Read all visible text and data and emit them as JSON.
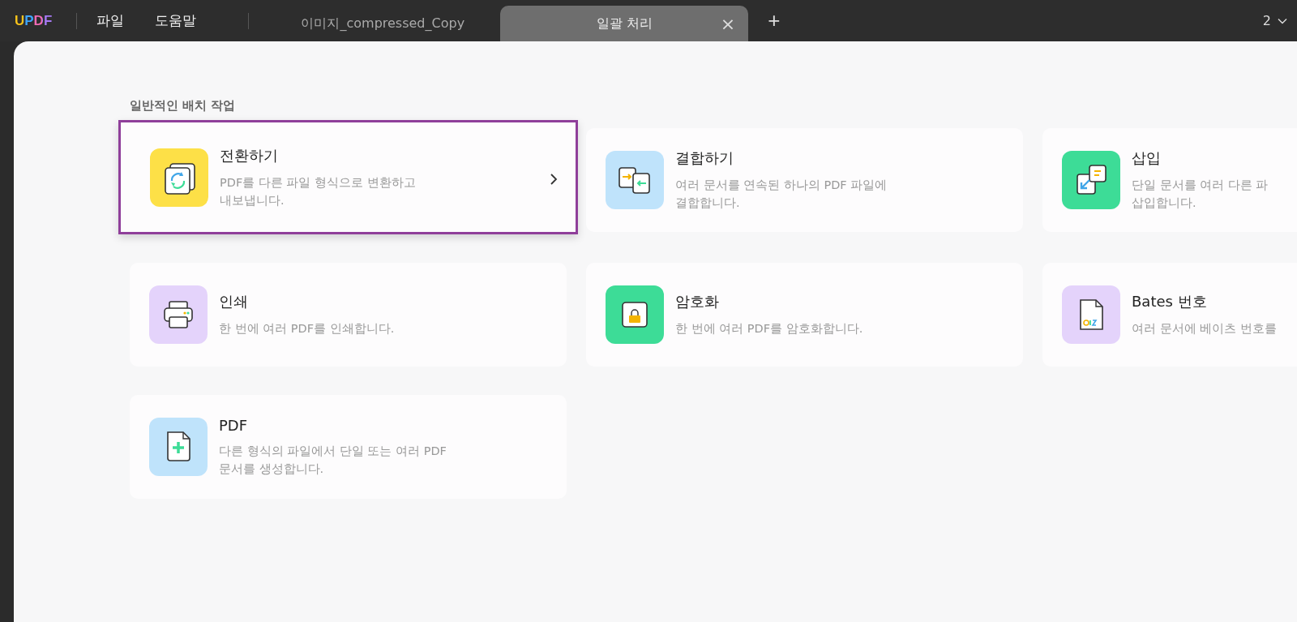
{
  "app_bar": {
    "logo": "UPDF",
    "menu": [
      "파일",
      "도움말"
    ],
    "tabs": [
      {
        "label": "이미지_compressed_Copy",
        "selected": false
      },
      {
        "label": "일괄 처리",
        "selected": true,
        "close": "×"
      }
    ],
    "new_tab": "+",
    "window_count": "2"
  },
  "section_title": "일반적인 배치 작업",
  "tasks": [
    {
      "kind": "convert",
      "title": "전환하기",
      "description": [
        "PDF를 다른 파일 형식으로 변환하고",
        "내보냅니다."
      ],
      "selected": true
    },
    {
      "kind": "combine",
      "title": "결합하기",
      "description": [
        "여러 문서를 연속된 하나의 PDF 파일에",
        "결합합니다."
      ],
      "selected": false
    },
    {
      "kind": "insert",
      "title": "삽입",
      "description": [
        "단일 문서를 여러 다른 파",
        "삽입합니다."
      ],
      "selected": false
    },
    {
      "kind": "print",
      "title": "인쇄",
      "description": [
        "한 번에 여러 PDF를 인쇄합니다."
      ],
      "selected": false
    },
    {
      "kind": "encrypt",
      "title": "암호화",
      "description": [
        "한 번에 여러 PDF를 암호화합니다."
      ],
      "selected": false
    },
    {
      "kind": "bates",
      "title": "Bates 번호",
      "description": [
        "여러 문서에 베이츠 번호를"
      ],
      "selected": false
    },
    {
      "kind": "create",
      "title": "PDF",
      "description": [
        "다른 형식의 파일에서 단일 또는 여러 PDF",
        "문서를 생성합니다."
      ],
      "selected": false
    }
  ]
}
